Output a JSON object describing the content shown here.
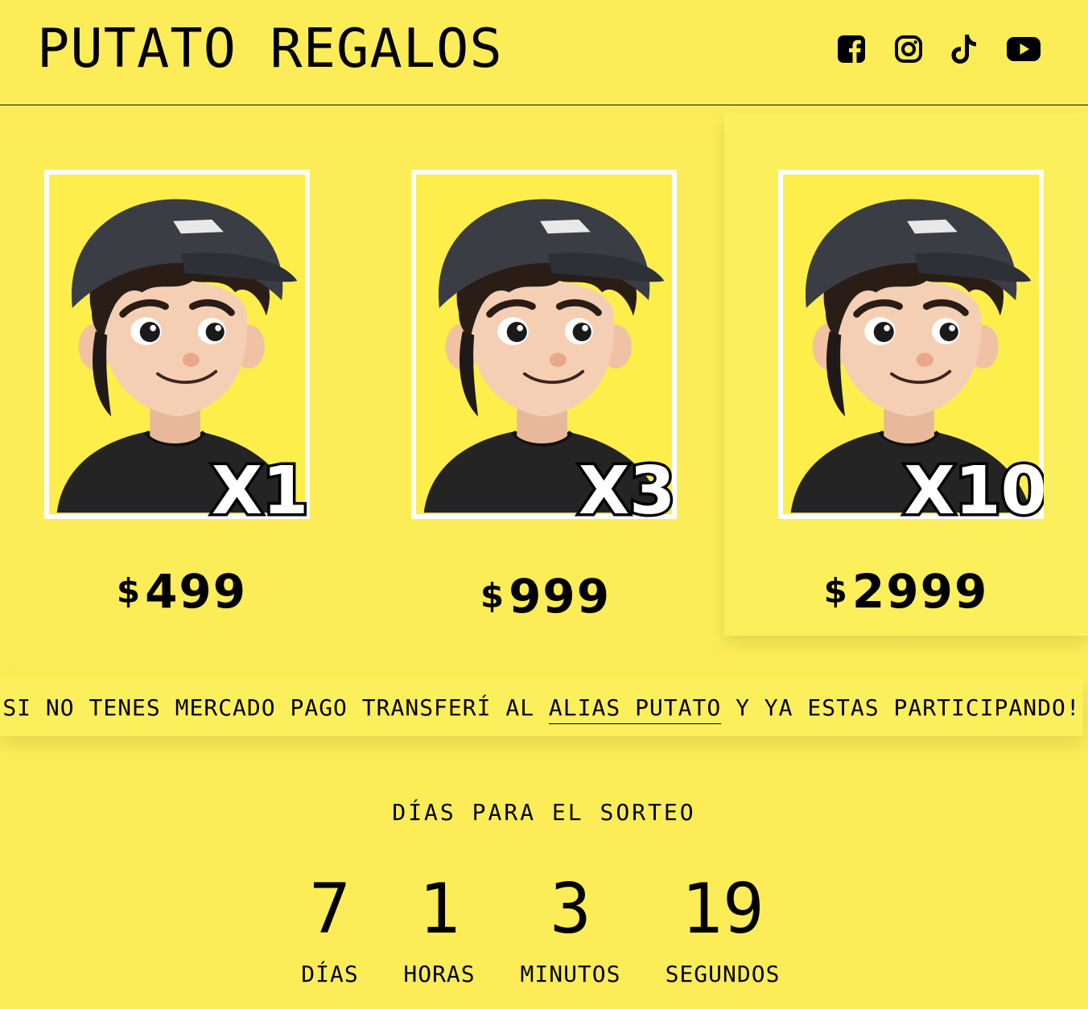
{
  "header": {
    "brand": "PUTATO REGALOS",
    "social": [
      {
        "name": "facebook-icon"
      },
      {
        "name": "instagram-icon"
      },
      {
        "name": "tiktok-icon"
      },
      {
        "name": "youtube-icon"
      }
    ]
  },
  "products": [
    {
      "badge": "X1",
      "currency": "$",
      "price": "499"
    },
    {
      "badge": "X3",
      "currency": "$",
      "price": "999"
    },
    {
      "badge": "X10",
      "currency": "$",
      "price": "2999"
    }
  ],
  "banner": {
    "before": "SI NO TENES MERCADO PAGO TRANSFERÍ AL ",
    "alias": "ALIAS PUTATO",
    "after": " Y YA ESTAS PARTICIPANDO!"
  },
  "countdown": {
    "title": "DÍAS PARA EL SORTEO",
    "units": [
      {
        "value": "7",
        "label": "DÍAS"
      },
      {
        "value": "1",
        "label": "HORAS"
      },
      {
        "value": "3",
        "label": "MINUTOS"
      },
      {
        "value": "19",
        "label": "SEGUNDOS"
      }
    ]
  },
  "colors": {
    "background": "#fced58",
    "card": "#fcef5c",
    "text": "#000000"
  }
}
